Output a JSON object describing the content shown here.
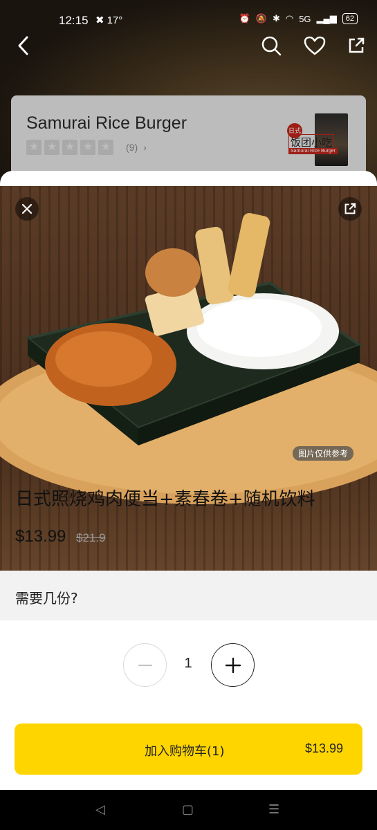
{
  "status_bar": {
    "time": "12:15",
    "temperature": "17°",
    "battery": "62",
    "network": "5G"
  },
  "store": {
    "name": "Samurai Rice Burger",
    "rating_count": "(9)",
    "logo_badge": "日式",
    "logo_text": "饭团小吃",
    "logo_subtext": "Samurai Rice Burger"
  },
  "item": {
    "photo_note": "图片仅供参考",
    "title": "日式照烧鸡肉便当+素春卷+随机饮料",
    "price": "$13.99",
    "original_price": "$21.9",
    "quantity_question": "需要几份?",
    "quantity": "1"
  },
  "cart": {
    "add_label": "加入购物车(1)",
    "total": "$13.99"
  },
  "colors": {
    "accent": "#ffd500",
    "sheet_bg": "#ffffff",
    "section_bg": "#f2f2f2"
  }
}
